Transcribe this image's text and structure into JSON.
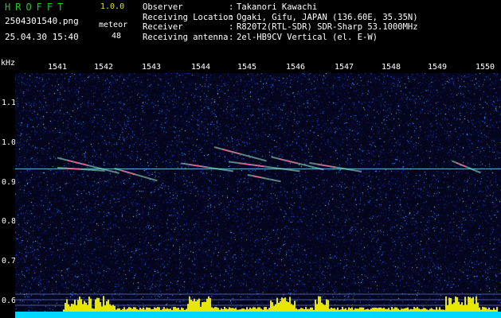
{
  "app": {
    "name": "HROFFT",
    "version": "1.0.0"
  },
  "file": {
    "name": "2504301540.png",
    "datetime": "25.04.30 15:40"
  },
  "meteor": {
    "label": "meteor",
    "count": "48"
  },
  "station": [
    {
      "label": "Observer",
      "colon": ":",
      "value": "Takanori Kawachi"
    },
    {
      "label": "Receiving Location",
      "colon": ":",
      "value": "Ogaki, Gifu, JAPAN (136.60E, 35.35N)"
    },
    {
      "label": "Receiver",
      "colon": ":",
      "value": "R820T2(RTL-SDR) SDR-Sharp 53.1000MHz"
    },
    {
      "label": "Receiving antenna",
      "colon": ":",
      "value": "2el-HB9CV Vertical (el. E-W)"
    }
  ],
  "axis": {
    "unit": "kHz",
    "x_ticks": [
      "1541",
      "1542",
      "1543",
      "1544",
      "1545",
      "1546",
      "1547",
      "1548",
      "1549",
      "1550"
    ],
    "y_ticks": [
      "1.1",
      "1.0",
      "0.9",
      "0.8",
      "0.7",
      "0.6"
    ]
  },
  "colors": {
    "app_name": "#19d319",
    "version": "#e6e600",
    "background": "#04061e",
    "carrier": "#7fd0ff",
    "bars": "#e6e600",
    "baseline": "#00d8ff"
  },
  "chart_data": {
    "type": "heatmap",
    "x_range": [
      1540.6,
      1550.2
    ],
    "y_range": [
      0.585,
      1.165
    ],
    "x_ticks": [
      1541,
      1542,
      1543,
      1544,
      1545,
      1546,
      1547,
      1548,
      1549,
      1550
    ],
    "y_ticks": [
      1.1,
      1.0,
      0.9,
      0.8,
      0.7,
      0.6
    ],
    "carrier_khz": 0.935,
    "meteor_streaks": [
      {
        "x0": 1541.0,
        "y0": 0.963,
        "x1": 1542.3,
        "y1": 0.924
      },
      {
        "x0": 1541.0,
        "y0": 0.938,
        "x1": 1542.0,
        "y1": 0.93
      },
      {
        "x0": 1542.2,
        "y0": 0.936,
        "x1": 1543.1,
        "y1": 0.905
      },
      {
        "x0": 1543.6,
        "y0": 0.949,
        "x1": 1544.7,
        "y1": 0.929
      },
      {
        "x0": 1544.3,
        "y0": 0.99,
        "x1": 1545.4,
        "y1": 0.955
      },
      {
        "x0": 1544.6,
        "y0": 0.953,
        "x1": 1546.1,
        "y1": 0.929
      },
      {
        "x0": 1545.5,
        "y0": 0.965,
        "x1": 1546.6,
        "y1": 0.933
      },
      {
        "x0": 1546.3,
        "y0": 0.95,
        "x1": 1547.4,
        "y1": 0.928
      },
      {
        "x0": 1545.0,
        "y0": 0.92,
        "x1": 1545.7,
        "y1": 0.903
      },
      {
        "x0": 1549.3,
        "y0": 0.955,
        "x1": 1549.9,
        "y1": 0.925
      }
    ],
    "grid": false,
    "legend": "none"
  }
}
